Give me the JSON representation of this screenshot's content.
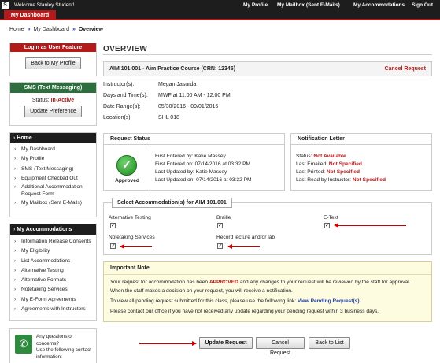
{
  "topbar": {
    "logo": "S",
    "welcome": "Welcome Stanley Student!",
    "links": [
      "My Profile",
      "My Mailbox (Sent E-Mails)",
      "My Accommodations",
      "Sign Out"
    ]
  },
  "tab": {
    "label": "My Dashboard"
  },
  "breadcrumb": {
    "home": "Home",
    "dashboard": "My Dashboard",
    "current": "Overview",
    "sep": "»"
  },
  "sidebar": {
    "login_title": "Login as User Feature",
    "back_button": "Back to My Profile",
    "sms_title": "SMS (Text Messaging)",
    "status_label": "Status:",
    "status_value": "In-Active",
    "update_button": "Update Preference",
    "home_title": "Home",
    "home_items": [
      "My Dashboard",
      "My Profile",
      "SMS (Text Messaging)",
      "Equipment Checked Out",
      "Additional Accommodation",
      "Request Form",
      "My Mailbox (Sent E-Mails)"
    ],
    "acc_title": "My Accommodations",
    "acc_items": [
      "Information Release Consents",
      "My Eligibility",
      "List Accommodations",
      "Alternative Testing",
      "Alternative Formats",
      "Notetaking Services",
      "My E-Form Agreements",
      "Agreements with Instructors"
    ],
    "help_line1": "Any questions or concerns?",
    "help_line2": "Use the following contact",
    "help_line3": "information:"
  },
  "main": {
    "title": "OVERVIEW",
    "course": "AIM 101.001 - Aim Practice Course  (CRN: 12345)",
    "cancel": "Cancel Request",
    "info": [
      {
        "k": "Instructor(s):",
        "v": "Megan Jasurda"
      },
      {
        "k": "Days and Time(s):",
        "v": "MWF at 11:00 AM - 12:00 PM"
      },
      {
        "k": "Date Range(s):",
        "v": "05/30/2016 - 09/01/2016"
      },
      {
        "k": "Location(s):",
        "v": "SHL 018"
      }
    ]
  },
  "request_status": {
    "title": "Request Status",
    "badge": "Approved",
    "rows": [
      {
        "k": "First Entered by:",
        "v": "Katie Massey"
      },
      {
        "k": "First Entered on:",
        "v": "07/14/2016 at 03:32 PM"
      },
      {
        "k": "Last Updated by:",
        "v": "Katie Massey"
      },
      {
        "k": "Last Updated on:",
        "v": "07/14/2016 at 03:32 PM"
      }
    ]
  },
  "notification": {
    "title": "Notification Letter",
    "rows": [
      {
        "k": "Status:",
        "v": "Not Available"
      },
      {
        "k": "Last Emailed:",
        "v": "Not Specified"
      },
      {
        "k": "Last Printed:",
        "v": "Not Specified"
      },
      {
        "k": "Last Read by Instructor:",
        "v": "Not Specified"
      }
    ]
  },
  "accommodations": {
    "legend": "Select Accommodation(s) for AIM 101.001",
    "items": [
      "Alternative Testing",
      "Braille",
      "E-Text",
      "Notetaking Services",
      "Record lecture and/or lab"
    ],
    "checked_mark": "✓"
  },
  "note": {
    "title": "Important Note",
    "p1a": "Your request for accommodation has been ",
    "p1b": "APPROVED",
    "p1c": " and any changes to your request will be reviewed by the staff for approval.",
    "p2": "When the staff makes a decision on your request, you will receive a notification.",
    "p3a": "To view all pending request submitted for this class, please use the following link: ",
    "p3b": "View Pending Request(s)",
    "p3c": ".",
    "p4": "Please contact our office if you have not received any update regarding your pending request within 3 business days."
  },
  "buttons": {
    "update": "Update Request",
    "cancel": "Cancel Request",
    "back": "Back to List"
  },
  "colors": {
    "brand_red": "#b31b1b",
    "sms_green": "#2e6e3e",
    "link_blue": "#1f3fa8"
  }
}
